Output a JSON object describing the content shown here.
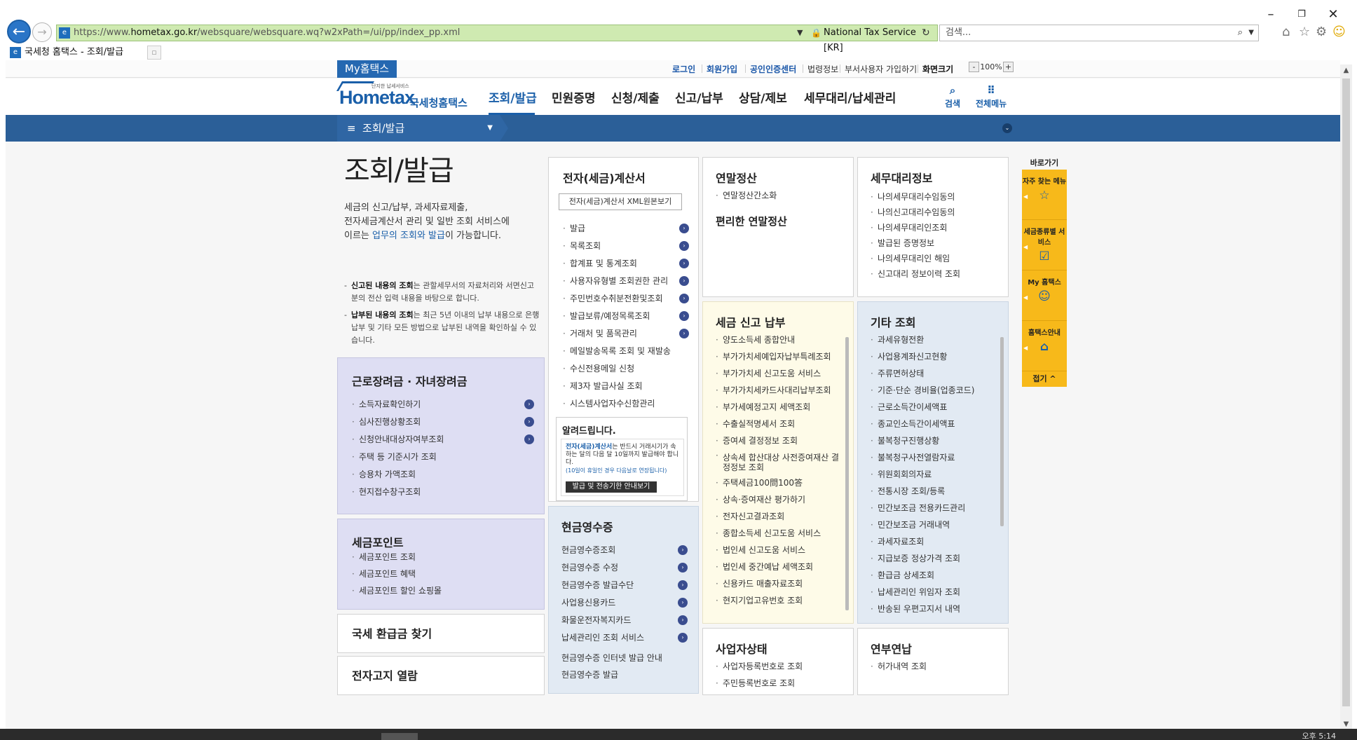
{
  "browser": {
    "url_prefix": "https://www.",
    "url_domain": "hometax.go.kr",
    "url_path": "/websquare/websquare.wq?w2xPath=/ui/pp/index_pp.xml",
    "cert_label": "National Tax Service [KR]",
    "search_placeholder": "검색...",
    "tab_title": "국세청 홈택스 - 조회/발급",
    "window_controls": [
      "minimize",
      "restore",
      "close"
    ],
    "toolbar_icons": [
      "home-icon",
      "star-icon",
      "gear-icon",
      "smiley-icon"
    ]
  },
  "util": {
    "my_hometax": "My홈택스",
    "links": [
      "로그인",
      "회원가입",
      "공인인증센터",
      "법령정보",
      "부서사용자 가입하기",
      "화면크기"
    ],
    "zoom_minus": "-",
    "zoom_value": "100%",
    "zoom_plus": "+"
  },
  "header": {
    "logo_small": "단지한 납세서비스",
    "logo_brand": "Hometax",
    "logo_sub": "국세청홈택스",
    "nav": [
      "조회/발급",
      "민원증명",
      "신청/제출",
      "신고/납부",
      "상담/제보",
      "세무대리/납세관리"
    ],
    "search_label": "검색",
    "allmenu_label": "전체메뉴"
  },
  "location": {
    "current": "조회/발급"
  },
  "intro": {
    "title": "조회/발급",
    "desc_1": "세금의 신고/납부, 과세자료제출,",
    "desc_2": "전자세금계산서 관리 및 일반 조회 서비스에",
    "desc_3a": "이르는 ",
    "desc_3b": "업무의 조회와 발급",
    "desc_3c": "이 가능합니다.",
    "note1_b": "신고된 내용의 조회",
    "note1_t": "는 관할세무서의 자료처리와 서면신고분의 전산 입력 내용을 바탕으로 합니다.",
    "note2_b": "납부된 내용의 조회",
    "note2_t": "는 최근 5년 이내의 납부 내용으로 은행 납부 및 기타 모든 방법으로 납부된 내역을 확인하실 수 있습니다."
  },
  "boxes": {
    "labor": {
      "title": "근로장려금 · 자녀장려금",
      "items": [
        "소득자료확인하기",
        "심사진행상황조회",
        "신청안내대상자여부조회",
        "주택 등 기준시가 조회",
        "승용차 가액조회",
        "현지접수창구조회"
      ]
    },
    "point": {
      "title": "세금포인트",
      "items": [
        "세금포인트 조회",
        "세금포인트 혜택",
        "세금포인트 할인 쇼핑몰"
      ]
    },
    "refund": {
      "title": "국세 환급금 찾기"
    },
    "notice_view": {
      "title": "전자고지 열람"
    },
    "einvoice": {
      "title": "전자(세금)계산서",
      "xml_button": "전자(세금)계산서 XML원본보기",
      "items": [
        "발급",
        "목록조회",
        "합계표 및 통계조회",
        "사용자유형별 조회권한 관리",
        "주민번호수취분전환및조회",
        "발급보류/예정목록조회",
        "거래처 및 품목관리",
        "메일발송목록 조회 및 재발송",
        "수신전용메일 신청",
        "제3자 발급사실 조회",
        "시스템사업자수신함관리"
      ]
    },
    "notice": {
      "title": "알려드립니다.",
      "text_b": "전자(세금)계산서",
      "text_1": "는 반드시 거래시기가 속하는 달의 다음 달 10일까지 발급",
      "text_2": "해야 합니다.",
      "small": "(10일이 휴일인 경우 다음날로 연장됩니다)",
      "button": "발급 및 전송기한 안내보기"
    },
    "cash": {
      "title": "현금영수증",
      "items": [
        "현금영수증조회",
        "현금영수증 수정",
        "현금영수증 발급수단",
        "사업용신용카드",
        "화물운전자복지카드",
        "납세관리인 조회 서비스",
        "현금영수증 인터넷 발급 안내",
        "현금영수증 발급"
      ]
    },
    "yearend": {
      "title": "연말정산",
      "items": [
        "연말정산간소화"
      ],
      "sub": "편리한 연말정산"
    },
    "taxagent": {
      "title": "세무대리정보",
      "items": [
        "나의세무대리수임동의",
        "나의신고대리수임동의",
        "나의세무대리인조회",
        "발급된 증명정보",
        "나의세무대리인 해임",
        "신고대리 정보이력 조회"
      ]
    },
    "taxreport": {
      "title": "세금 신고 납부",
      "items": [
        "양도소득세 종합안내",
        "부가가치세예입자납부특례조회",
        "부가가치세 신고도움 서비스",
        "부가가치세카드사대리납부조회",
        "부가세예정고지 세액조회",
        "수출실적명세서 조회",
        "증여세 결정정보 조회",
        "상속세 합산대상 사전증여재산 결정정보 조회",
        "주택세금100問100答",
        "상속·증여재산 평가하기",
        "전자신고결과조회",
        "종합소득세 신고도움 서비스",
        "법인세 신고도움 서비스",
        "법인세 중간예납 세액조회",
        "신용카드 매출자료조회",
        "현지기업고유번호 조회"
      ]
    },
    "other": {
      "title": "기타 조회",
      "items": [
        "과세유형전환",
        "사업용계좌신고현황",
        "주류면허상태",
        "기준·단순 경비율(업종코드)",
        "근로소득간이세액표",
        "종교인소득간이세액표",
        "불복청구진행상황",
        "불복청구사전열람자료",
        "위원회회의자료",
        "전통시장 조회/등록",
        "민간보조금 전용카드관리",
        "민간보조금 거래내역",
        "과세자료조회",
        "지급보증 정상가격 조회",
        "환급금 상세조회",
        "납세관리인 위임자 조회",
        "반송된 우편고지서 내역"
      ]
    },
    "bizstatus": {
      "title": "사업자상태",
      "items": [
        "사업자등록번호로 조회",
        "주민등록번호로 조회"
      ]
    },
    "annuity": {
      "title": "연부연납",
      "items": [
        "허가내역 조회"
      ]
    }
  },
  "quick": {
    "title": "바로가기",
    "items": [
      {
        "label": "자주 찾는 메뉴",
        "icon": "star-icon"
      },
      {
        "label": "세금종류별 서비스",
        "icon": "checkbox-icon"
      },
      {
        "label": "My 홈택스",
        "icon": "person-icon"
      },
      {
        "label": "홈택스안내",
        "icon": "house-icon"
      }
    ],
    "close": "접기 ^"
  },
  "taskbar": {
    "clock": "오후 5:14"
  }
}
